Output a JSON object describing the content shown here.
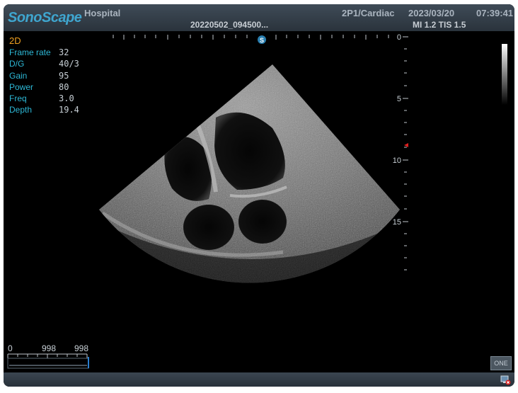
{
  "header": {
    "logo": "SonoScape",
    "hospital": "Hospital",
    "patient_id": "20220502_094500...",
    "preset": "2P1/Cardiac",
    "date": "2023/03/20",
    "time": "07:39:41",
    "mi_tis": "MI 1.2  TIS 1.5"
  },
  "params": {
    "mode": "2D",
    "rows": [
      {
        "label": "Frame rate",
        "value": "32"
      },
      {
        "label": "D/G",
        "value": "40/3"
      },
      {
        "label": "Gain",
        "value": "95"
      },
      {
        "label": "Power",
        "value": "80"
      },
      {
        "label": "Freq",
        "value": "3.0"
      },
      {
        "label": "Depth",
        "value": "19.4"
      }
    ]
  },
  "depth_scale": {
    "labels": [
      "0",
      "5",
      "10",
      "15"
    ],
    "focus_color": "#e02020"
  },
  "cine": {
    "start": "0",
    "mid": "998",
    "end": "998"
  },
  "buttons": {
    "one_label": "ONE"
  },
  "colors": {
    "accent_cyan": "#2db8d6",
    "mode_orange": "#f0a020"
  }
}
